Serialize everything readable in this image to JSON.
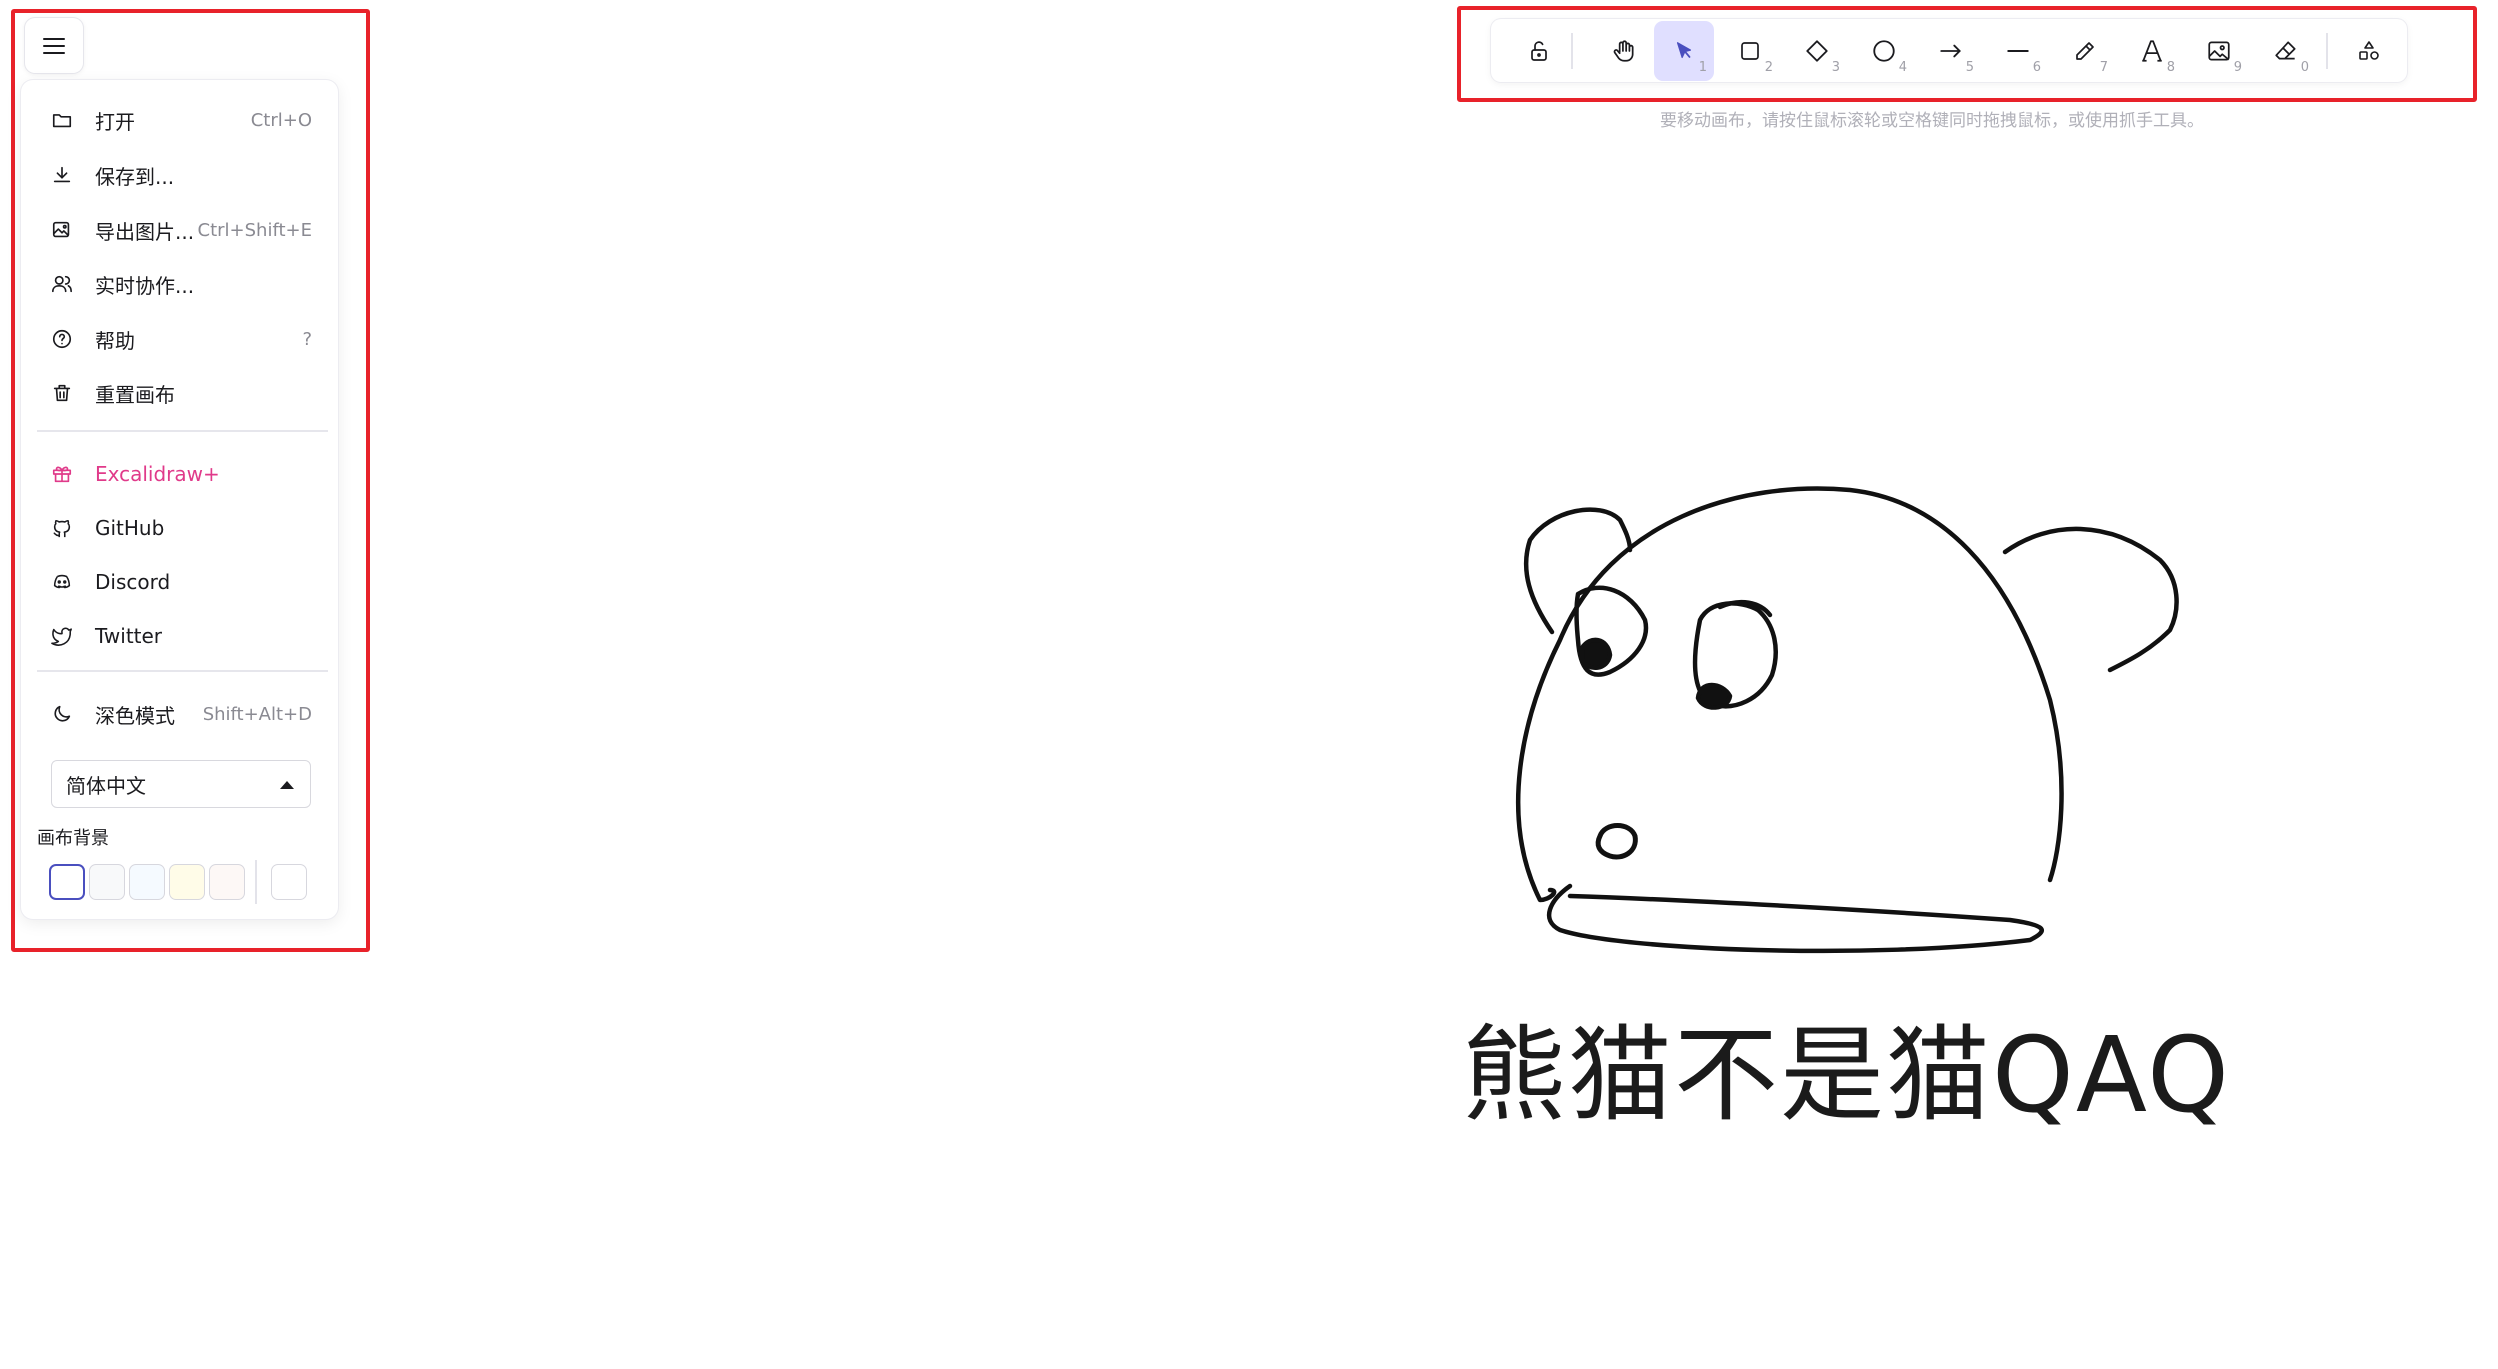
{
  "menu": {
    "items_top": [
      {
        "label": "打开",
        "shortcut": "Ctrl+O",
        "icon": "folder-icon"
      },
      {
        "label": "保存到...",
        "shortcut": "",
        "icon": "download-icon"
      },
      {
        "label": "导出图片...",
        "shortcut": "Ctrl+Shift+E",
        "icon": "export-image-icon"
      },
      {
        "label": "实时协作...",
        "shortcut": "",
        "icon": "users-icon"
      },
      {
        "label": "帮助",
        "shortcut": "?",
        "icon": "help-circle-icon"
      },
      {
        "label": "重置画布",
        "shortcut": "",
        "icon": "trash-icon"
      }
    ],
    "items_links": [
      {
        "label": "Excalidraw+",
        "icon": "gift-icon"
      },
      {
        "label": "GitHub",
        "icon": "github-icon"
      },
      {
        "label": "Discord",
        "icon": "discord-icon"
      },
      {
        "label": "Twitter",
        "icon": "twitter-icon"
      }
    ],
    "dark_mode": {
      "label": "深色模式",
      "shortcut": "Shift+Alt+D",
      "icon": "moon-icon"
    },
    "language": "简体中文",
    "canvas_bg_label": "画布背景",
    "bg_colors": [
      "#ffffff",
      "#f8f9fa",
      "#f5faff",
      "#fffce8",
      "#fdf8f6"
    ],
    "bg_custom": "#ffffff"
  },
  "toolbar": {
    "tools": [
      {
        "name": "lock-icon",
        "num": ""
      },
      {
        "name": "hand-icon",
        "num": ""
      },
      {
        "name": "selection-icon",
        "num": "1",
        "active": true
      },
      {
        "name": "rectangle-icon",
        "num": "2"
      },
      {
        "name": "diamond-icon",
        "num": "3"
      },
      {
        "name": "ellipse-icon",
        "num": "4"
      },
      {
        "name": "arrow-icon",
        "num": "5"
      },
      {
        "name": "line-icon",
        "num": "6"
      },
      {
        "name": "pencil-icon",
        "num": "7"
      },
      {
        "name": "text-icon",
        "num": "8"
      },
      {
        "name": "image-icon",
        "num": "9"
      },
      {
        "name": "eraser-icon",
        "num": "0"
      },
      {
        "name": "shapes-library-icon",
        "num": ""
      }
    ],
    "hint": "要移动画布，请按住鼠标滚轮或空格键同时拖拽鼠标，或使用抓手工具。"
  },
  "canvas": {
    "caption": "熊猫不是猫QAQ"
  },
  "colors": {
    "accent": "#6965db",
    "active_bg": "#e0dfff",
    "pink": "#e03a8a",
    "annotation": "#e8222a"
  }
}
